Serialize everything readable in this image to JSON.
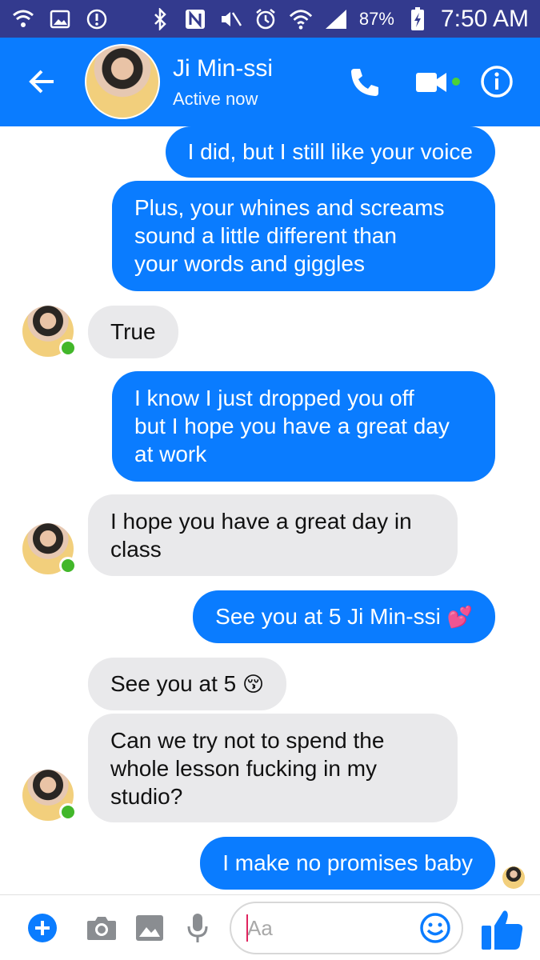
{
  "status_bar": {
    "battery": "87%",
    "time": "7:50 AM",
    "icons": [
      "wifi-calling-icon",
      "image-icon",
      "alert-icon",
      "bluetooth-icon",
      "nfc-icon",
      "mute-icon",
      "alarm-icon",
      "wifi-icon",
      "signal-icon",
      "battery-charging-icon"
    ]
  },
  "header": {
    "contact_name": "Ji Min-ssi",
    "status": "Active now",
    "icons": [
      "back-arrow-icon",
      "phone-icon",
      "video-camera-icon",
      "info-icon"
    ]
  },
  "messages": [
    {
      "from": "me",
      "text": "I did,  but I still like your voice"
    },
    {
      "from": "me",
      "lines": [
        "Plus, your whines and screams",
        "sound a little different than",
        "your words and giggles"
      ]
    },
    {
      "from": "them",
      "text": "True"
    },
    {
      "from": "me",
      "lines": [
        "I know I just dropped you off",
        "but I hope you have a great day",
        "at work"
      ]
    },
    {
      "from": "them",
      "lines": [
        "I hope you have a great day in",
        "class"
      ]
    },
    {
      "from": "me",
      "text": "See you at 5 Ji Min-ssi",
      "emoji": "💕"
    },
    {
      "from": "them",
      "text": "See you at 5",
      "emoji": "😚"
    },
    {
      "from": "them",
      "lines": [
        "Can we try not to spend the",
        "whole lesson fucking in my",
        "studio?"
      ]
    },
    {
      "from": "me",
      "text": "I make no promises baby"
    }
  ],
  "composer": {
    "placeholder": "Aa",
    "value": "",
    "icons": [
      "add-icon",
      "camera-icon",
      "gallery-icon",
      "microphone-icon",
      "emoji-icon",
      "thumbs-up-icon"
    ]
  },
  "colors": {
    "status_bar": "#333a8e",
    "header": "#0a7cff",
    "outgoing_bubble": "#0a7cff",
    "incoming_bubble": "#e9e9eb",
    "online": "#42b72a"
  }
}
